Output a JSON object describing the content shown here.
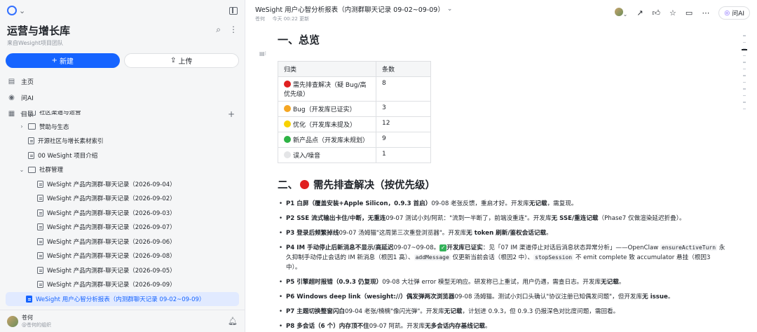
{
  "sidebar": {
    "space_title": "运营与增长库",
    "space_subtitle": "来自Wesight项目团队",
    "new_button": "新建",
    "upload_button": "上传",
    "nav": [
      {
        "label": "主页",
        "icon": "home-icon"
      },
      {
        "label": "问AI",
        "icon": "ai-icon"
      },
      {
        "label": "目录",
        "icon": "toc-icon"
      }
    ],
    "tree": [
      {
        "label": "社区渠道与运营",
        "type": "folder",
        "level": 1,
        "caret": "expanded"
      },
      {
        "label": "赞助与生态",
        "type": "folder",
        "level": 1,
        "caret": "collapsed"
      },
      {
        "label": "开源社区与增长素材索引",
        "type": "doc",
        "level": 1
      },
      {
        "label": "00 WeSight 项目介绍",
        "type": "doc",
        "level": 1
      },
      {
        "label": "社群管理",
        "type": "folder",
        "level": 1,
        "caret": "expanded"
      },
      {
        "label": "WeSight 产品内测群-聊天记录（2026-09-04）",
        "type": "doc",
        "level": 2
      },
      {
        "label": "WeSight 产品内测群-聊天记录（2026-09-02）",
        "type": "doc",
        "level": 2
      },
      {
        "label": "WeSight 产品内测群-聊天记录（2026-09-03）",
        "type": "doc",
        "level": 2
      },
      {
        "label": "WeSight 产品内测群-聊天记录（2026-09-07）",
        "type": "doc",
        "level": 2
      },
      {
        "label": "WeSight 产品内测群-聊天记录（2026-09-06）",
        "type": "doc",
        "level": 2
      },
      {
        "label": "WeSight 产品内测群-聊天记录（2026-09-08）",
        "type": "doc",
        "level": 2
      },
      {
        "label": "WeSight 产品内测群-聊天记录（2026-09-05）",
        "type": "doc",
        "level": 2
      },
      {
        "label": "WeSight 产品内测群-聊天记录（2026-09-09）",
        "type": "doc",
        "level": 2
      },
      {
        "label": "WeSight 用户心智分析报表（内测群聊天记录 09-02~09-09）",
        "type": "doc",
        "level": 1,
        "active": true
      }
    ],
    "user_name": "苍何",
    "user_org": "@苍何的组织"
  },
  "topbar": {
    "doc_title": "WeSight 用户心智分析报表（内测群聊天记录 09-02~09-09）",
    "author": "苍何",
    "updated": "今天 00:22 更新",
    "ask_ai": "问AI"
  },
  "doc": {
    "h1": "一、总览",
    "table": {
      "headers": [
        "归类",
        "条数"
      ],
      "rows": [
        {
          "label": "需先排查解决（疑 Bug/高优先级）",
          "count": "8",
          "color": "#e02020"
        },
        {
          "label": "Bug（开发库已证实）",
          "count": "3",
          "color": "#f5a623"
        },
        {
          "label": "优化（开发库未提及）",
          "count": "12",
          "color": "#f8d200"
        },
        {
          "label": "新产品点（开发库未规划）",
          "count": "9",
          "color": "#2eb345"
        },
        {
          "label": "误入/噪音",
          "count": "1",
          "color": "#dcdcdc"
        }
      ]
    },
    "h2_prefix": "二、",
    "h2_text": "需先排查解决（按优先级）",
    "h2_color": "#e02020",
    "items": {
      "p1_title": "P1 白屏（覆盖安装+Apple Silicon，0.9.3 首启）",
      "p1_body_a": "09-08 老张反馈，重启才好。开发库",
      "p1_bold": "无记载",
      "p1_body_b": "，需复现。",
      "p2_title": "P2 SSE 流式输出卡住/中断，无重连",
      "p2_body_a": "09-07 测试小刘/阿凯：\"流到一半断了，前端没重连\"。开发库",
      "p2_bold": "无 SSE/重连记载",
      "p2_body_b": "（Phase7 仅做渲染延迟折叠）。",
      "p3_title": "P3 登录后频繁掉线",
      "p3_body_a": "09-07 汤姆猫\"这周第三次重登浏览器\"。开发库",
      "p3_bold": "无 token 刷新/鉴权会话记载",
      "p3_body_b": "。",
      "p4_title": "P4 IM 手动停止后新消息不显示/高延迟",
      "p4_body_a": "09-07~09-08。",
      "p4_check": "✓",
      "p4_bold2": "开发库已证实",
      "p4_body_b": "：见「07 IM 渠道停止对话后消息状态异常分析」——OpenClaw ",
      "p4_code1": "ensureActiveTurn",
      "p4_body_c": " 永久抑制手动停止会话的 IM 新消息（根因1 高）、",
      "p4_code2": "addMessage",
      "p4_body_d": " 仅更新当前会话（根因2 中）、",
      "p4_code3": "stopSession",
      "p4_body_e": " 不 emit complete 致 accumulator 悬挂（根因3 中）。",
      "p5_title": "P5 引擎超时报错（0.9.3 仍复现）",
      "p5_body_a": "09-08 大壮弹 error 模型无响应。研发称已上重试，用户仍遇，需查日志。开发库",
      "p5_bold": "无记载",
      "p5_body_b": "。",
      "p6_title": "P6 Windows deep link（wesight://）偶发弹两次浏览器",
      "p6_body_a": "09-08 汤姆猫。测试小刘口头确认\"协议注册已知偶发问题\"，但开发库",
      "p6_bold": "无 issue",
      "p6_body_b": "。",
      "p7_title": "P7 主题切换整窗闪白",
      "p7_body_a": "09-04 老张/楠楠\"像闪光弹\"。开发库",
      "p7_bold": "无记载",
      "p7_body_b": "，计划进 0.9.3，但 0.9.3 仍报深色对比度问题，需回看。",
      "p8_title": "P8 多会话（6 个）内存顶不住",
      "p8_body_a": "09-07 阿凯。开发库",
      "p8_bold": "无多会话内存基线记载",
      "p8_body_b": "。"
    }
  }
}
